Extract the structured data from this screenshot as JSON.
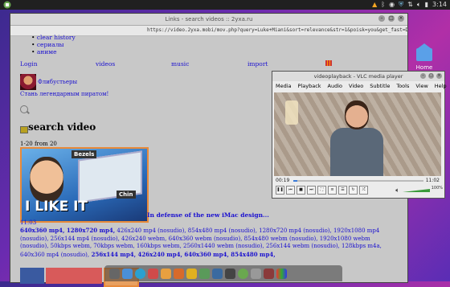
{
  "top_panel": {
    "time": "3:14",
    "menu_icon": "mint-menu-icon"
  },
  "browser": {
    "title": "Links - search videos :: 2yxa.ru",
    "url": "https://video.2yxa.mobi/mov.php?query=Luke+Miani&sort=relevance&str=1&poisk=you&get_fast=D8_gOHLg5o",
    "bullets": [
      "clear history",
      "сериалы",
      "аниме"
    ],
    "nav": [
      "Login",
      "videos",
      "music",
      "import"
    ],
    "user": {
      "name": "Флибустьеры",
      "slogan": "Стань легендарным пиратом!"
    },
    "heading": "search video",
    "count": "1-20 from 20",
    "result": {
      "thumb_texts": {
        "bezels": "Bezels",
        "chin": "Chin",
        "big": "I LIKE IT"
      },
      "title": "In defense of the new iMac design...",
      "duration": "11:03",
      "formats_bold1": "640x360 mp4, 1280x720 mp4,",
      "formats_normal": " 426x240 mp4 (nosudio), 854x480 mp4 (nosudio), 1280x720 mp4 (nosudio), 1920x1080 mp4 (nosudio), 256x144 mp4 (nosudio), 426x240 webm, 640x360 webm (nosudio), 854x480 webm (nosudio), 1920x1080 webm (nosudio), 50kbps webm, 70kbps webm, 160kbps webm, 2560x1440 webm (nosudio), 256x144 webm (nosudio), 128kbps m4a, 640x360 mp4 (nosudio),",
      "formats_bold2": " 256x144 mp4, 426x240 mp4, 640x360 mp4, 854x480 mp4,"
    }
  },
  "desktop": {
    "home_label": "Home"
  },
  "vlc": {
    "title": "videoplayback - VLC media player",
    "menu": [
      "Media",
      "Playback",
      "Audio",
      "Video",
      "Subtitle",
      "Tools",
      "View",
      "Help"
    ],
    "elapsed": "00:19",
    "total": "11:02",
    "progress": 0.03,
    "volume_text": "100%"
  },
  "colors": {
    "link": "#1a10d0",
    "accent_orange": "#e88a3a",
    "vlc_progress": "#3a7ad8"
  }
}
